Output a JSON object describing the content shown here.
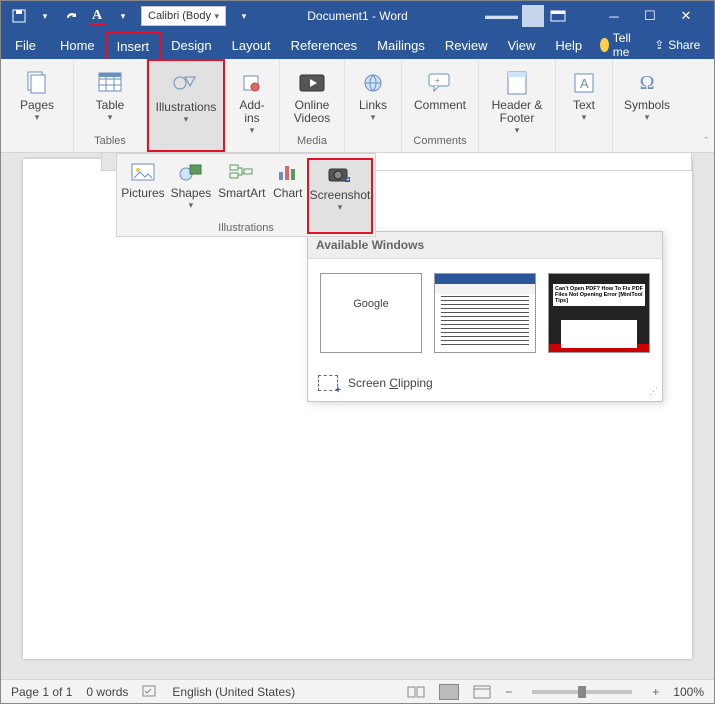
{
  "qat": {
    "font_name": "Calibri (Body"
  },
  "title": "Document1 - Word",
  "tabs": {
    "file": "File",
    "home": "Home",
    "insert": "Insert",
    "design": "Design",
    "layout": "Layout",
    "references": "References",
    "mailings": "Mailings",
    "review": "Review",
    "view": "View",
    "help": "Help",
    "tellme": "Tell me",
    "share": "Share"
  },
  "ribbon": {
    "pages": {
      "label": "Pages",
      "group": ""
    },
    "table": {
      "label": "Table",
      "group": "Tables"
    },
    "illustrations": {
      "label": "Illustrations",
      "group": ""
    },
    "addins": {
      "label": "Add-\nins",
      "group": ""
    },
    "videos": {
      "label": "Online\nVideos",
      "group": "Media"
    },
    "links": {
      "label": "Links",
      "group": ""
    },
    "comment": {
      "label": "Comment",
      "group": "Comments"
    },
    "header": {
      "label": "Header &\nFooter",
      "group": ""
    },
    "text": {
      "label": "Text",
      "group": ""
    },
    "symbols": {
      "label": "Symbols",
      "group": ""
    }
  },
  "illus": {
    "pictures": "Pictures",
    "shapes": "Shapes",
    "smartart": "SmartArt",
    "chart": "Chart",
    "screenshot": "Screenshot",
    "group_label": "Illustrations"
  },
  "shot": {
    "header": "Available Windows",
    "clip": "Screen Clipping"
  },
  "status": {
    "page": "Page 1 of 1",
    "words": "0 words",
    "lang": "English (United States)",
    "zoom": "100%"
  }
}
